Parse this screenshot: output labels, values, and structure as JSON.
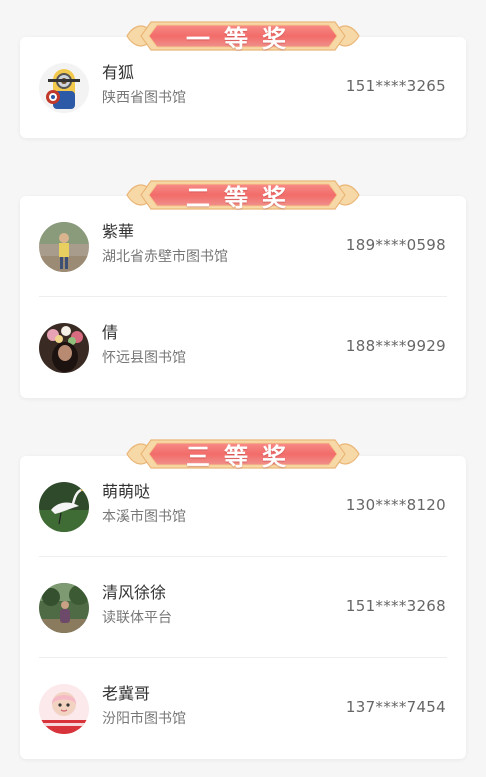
{
  "prizes": [
    {
      "title": "一等奖",
      "winners": [
        {
          "name": "有狐",
          "library": "陕西省图书馆",
          "phone": "151****3265",
          "avatar_icon": "minion-avatar"
        }
      ]
    },
    {
      "title": "二等奖",
      "winners": [
        {
          "name": "紫華",
          "library": "湖北省赤壁市图书馆",
          "phone": "189****0598",
          "avatar_icon": "person-photo-avatar"
        },
        {
          "name": "倩",
          "library": "怀远县图书馆",
          "phone": "188****9929",
          "avatar_icon": "flower-portrait-avatar"
        }
      ]
    },
    {
      "title": "三等奖",
      "winners": [
        {
          "name": "萌萌哒",
          "library": "本溪市图书馆",
          "phone": "130****8120",
          "avatar_icon": "egret-avatar"
        },
        {
          "name": "清风徐徐",
          "library": "读联体平台",
          "phone": "151****3268",
          "avatar_icon": "outdoor-photo-avatar"
        },
        {
          "name": "老冀哥",
          "library": "汾阳市图书馆",
          "phone": "137****7454",
          "avatar_icon": "cartoon-girl-avatar"
        }
      ]
    }
  ],
  "colors": {
    "banner_red": "#f26c6a",
    "banner_gold": "#f5c98a",
    "background": "#f6f6f6"
  }
}
